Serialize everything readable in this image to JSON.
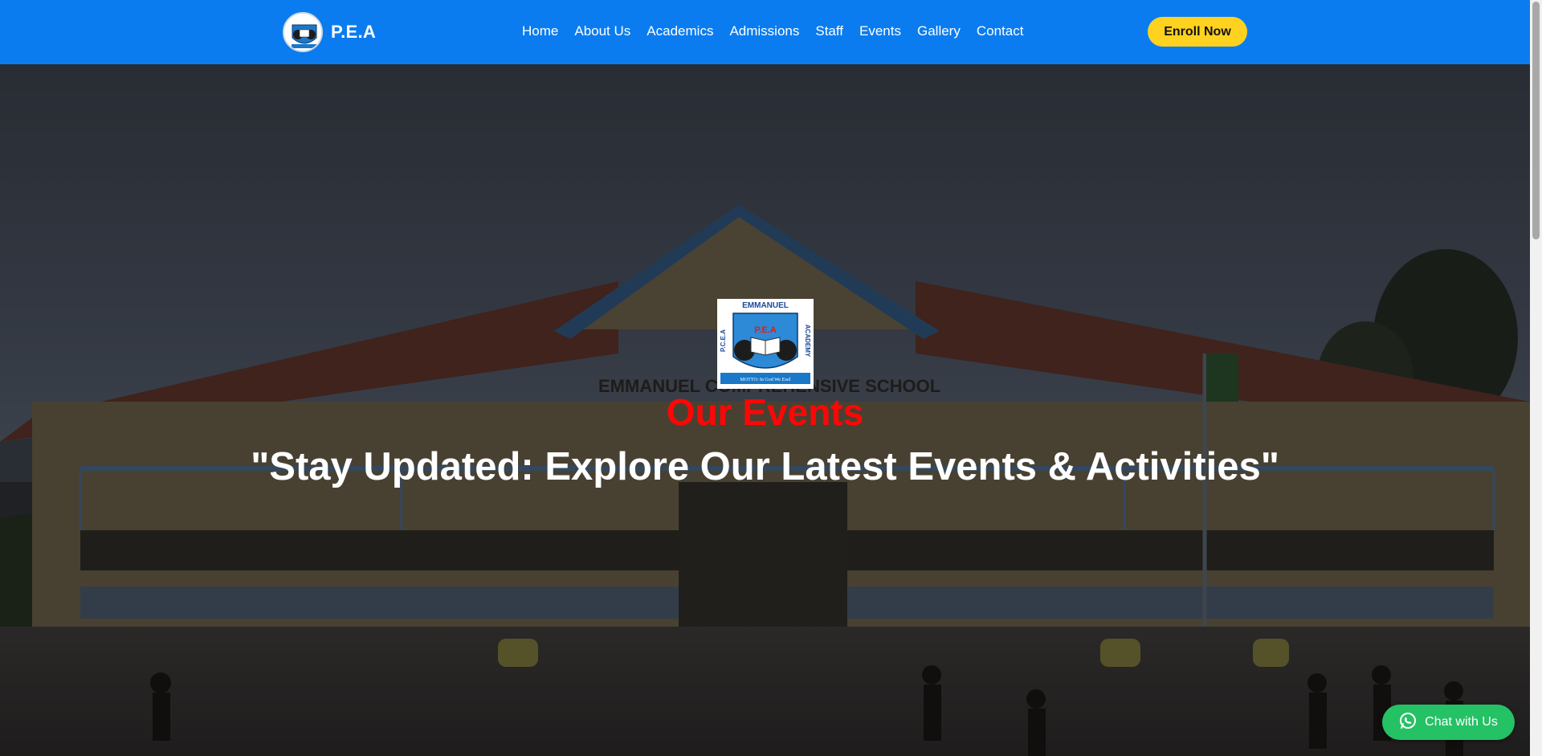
{
  "header": {
    "brand": "P.E.A",
    "logo_icon": "school-crest-icon",
    "nav": [
      {
        "label": "Home"
      },
      {
        "label": "About Us"
      },
      {
        "label": "Academics"
      },
      {
        "label": "Admissions"
      },
      {
        "label": "Staff"
      },
      {
        "label": "Events"
      },
      {
        "label": "Gallery"
      },
      {
        "label": "Contact"
      }
    ],
    "cta": "Enroll Now"
  },
  "hero": {
    "crest_top": "EMMANUEL",
    "crest_left": "P.C.E.A",
    "crest_right": "ACADEMY",
    "crest_center": "P.E.A",
    "crest_motto": "MOTTO: In God We Exel",
    "building_sign": "EMMANUEL COMPREHENSIVE SCHOOL",
    "title": "Our Events",
    "subtitle": "\"Stay Updated: Explore Our Latest Events & Activities\""
  },
  "chat": {
    "label": "Chat with Us",
    "icon": "whatsapp-icon"
  },
  "colors": {
    "header_bg": "#0a7cf0",
    "cta_bg": "#ffd21f",
    "title_red": "#ff0606",
    "chat_green": "#25c165"
  }
}
